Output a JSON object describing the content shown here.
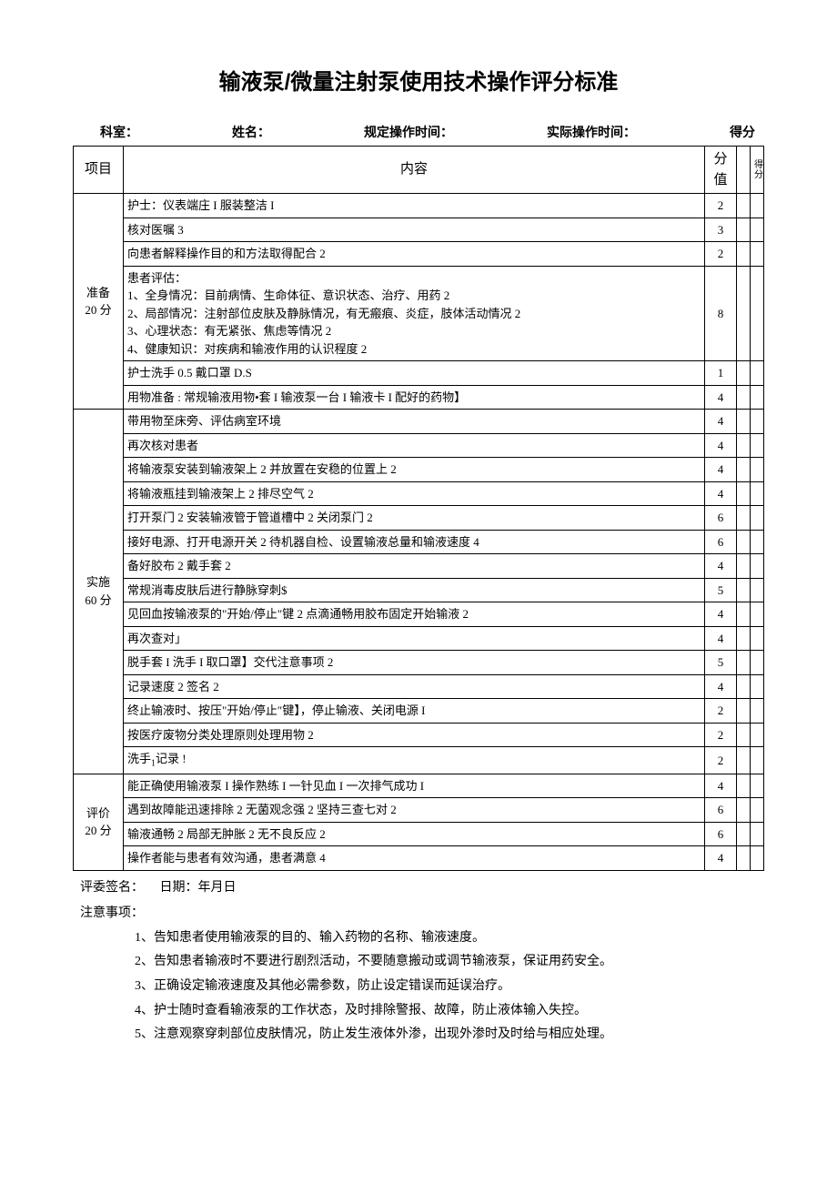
{
  "title": "输液泵/微量注射泵使用技术操作评分标准",
  "info": {
    "dept": "科室：",
    "name": "姓名：",
    "std_time": "规定操作时间：",
    "act_time": "实际操作时间：",
    "score": "得分"
  },
  "headers": {
    "item": "项目",
    "content": "内容",
    "score": "分值",
    "got": "得分"
  },
  "sections": [
    {
      "name": "准备\n20 分",
      "rows": [
        {
          "text": "护士：仪表端庄 I 服装整洁 I",
          "score": "2",
          "dashed": true
        },
        {
          "text": "核对医嘱 3",
          "score": "3",
          "dashed": true
        },
        {
          "text": "向患者解释操作目的和方法取得配合 2",
          "score": "2"
        },
        {
          "text": "患者评估：\n1、全身情况：目前病情、生命体征、意识状态、治疗、用药 2\n2、局部情况：注射部位皮肤及静脉情况，有无瘢痕、炎症，肢体活动情况 2\n3、心理状态：有无紧张、焦虑等情况 2\n4、健康知识：对疾病和输液作用的认识程度 2",
          "score": "8"
        },
        {
          "text": "护士洗手 0.5 戴口罩 D.S",
          "score": "1",
          "dashed": true
        },
        {
          "text": "用物准备 : 常规输液用物•套 I 输液泵一台 I 输液卡 I 配好的药物】",
          "score": "4"
        }
      ]
    },
    {
      "name": "实施\n60 分",
      "rows": [
        {
          "text": "带用物至床旁、评估病室环境",
          "score": "4",
          "dashed": true
        },
        {
          "text": "再次核对患者",
          "score": "4",
          "dashed": true
        },
        {
          "text": "将输液泵安装到输液架上 2 并放置在安稳的位置上 2",
          "score": "4",
          "dashed": true
        },
        {
          "text": "将输液瓶挂到输液架上 2 排尽空气 2",
          "score": "4"
        },
        {
          "text": "打开泵门 2 安装输液管于管道槽中 2 关闭泵门 2",
          "score": "6",
          "dashed": true
        },
        {
          "text": "接好电源、打开电源开关 2 待机器自检、设置输液总量和输液速度 4",
          "score": "6",
          "dashed": true
        },
        {
          "text": "备好胶布 2 戴手套 2",
          "score": "4"
        },
        {
          "text": "常规消毒皮肤后进行静脉穿刺$",
          "score": "5",
          "dashed": true
        },
        {
          "text": "见回血按输液泵的\"开始/停止\"键 2 点滴通畅用胶布固定开始输液 2",
          "score": "4",
          "dashed": true
        },
        {
          "text": "再次查对」",
          "score": "4"
        },
        {
          "text": "脱手套 I 洗手 I 取口罩】交代注意事项 2",
          "score": "5",
          "dashed": true
        },
        {
          "text": "记录速度 2 签名 2",
          "score": "4",
          "dashed": true
        },
        {
          "text": "终止输液时、按压\"开始/停止″键】，停止输液、关闭电源 I",
          "score": "2",
          "dashed": true
        },
        {
          "text": "按医疗废物分类处理原则处理用物 2",
          "score": "2",
          "dashed": true
        },
        {
          "text": "洗手₁记录 !",
          "score": "2"
        }
      ]
    },
    {
      "name": "评价\n20 分",
      "rows": [
        {
          "text": "能正确使用输液泵 I 操作熟练 I 一针见血 I 一次排气成功 I",
          "score": "4"
        },
        {
          "text": "遇到故障能迅速排除 2 无菌观念强 2 坚持三查七对 2",
          "score": "6",
          "dashed": true
        },
        {
          "text": "输液通畅 2 局部无肿胀 2 无不良反应 2",
          "score": "6"
        },
        {
          "text": "操作者能与患者有效沟通，患者满意 4",
          "score": "4"
        }
      ]
    }
  ],
  "footer": {
    "sign": "评委签名：",
    "date": "日期：年月日",
    "notes_title": "注意事项：",
    "notes": [
      "告知患者使用输液泵的目的、输入药物的名称、输液速度。",
      "告知患者输液时不要进行剧烈活动，不要随意搬动或调节输液泵，保证用药安全。",
      "正确设定输液速度及其他必需参数，防止设定错误而延误治疗。",
      "护士随时查看输液泵的工作状态，及时排除警报、故障，防止液体输入失控。",
      "注意观察穿刺部位皮肤情况，防止发生液体外渗，出现外渗时及时给与相应处理。"
    ]
  }
}
